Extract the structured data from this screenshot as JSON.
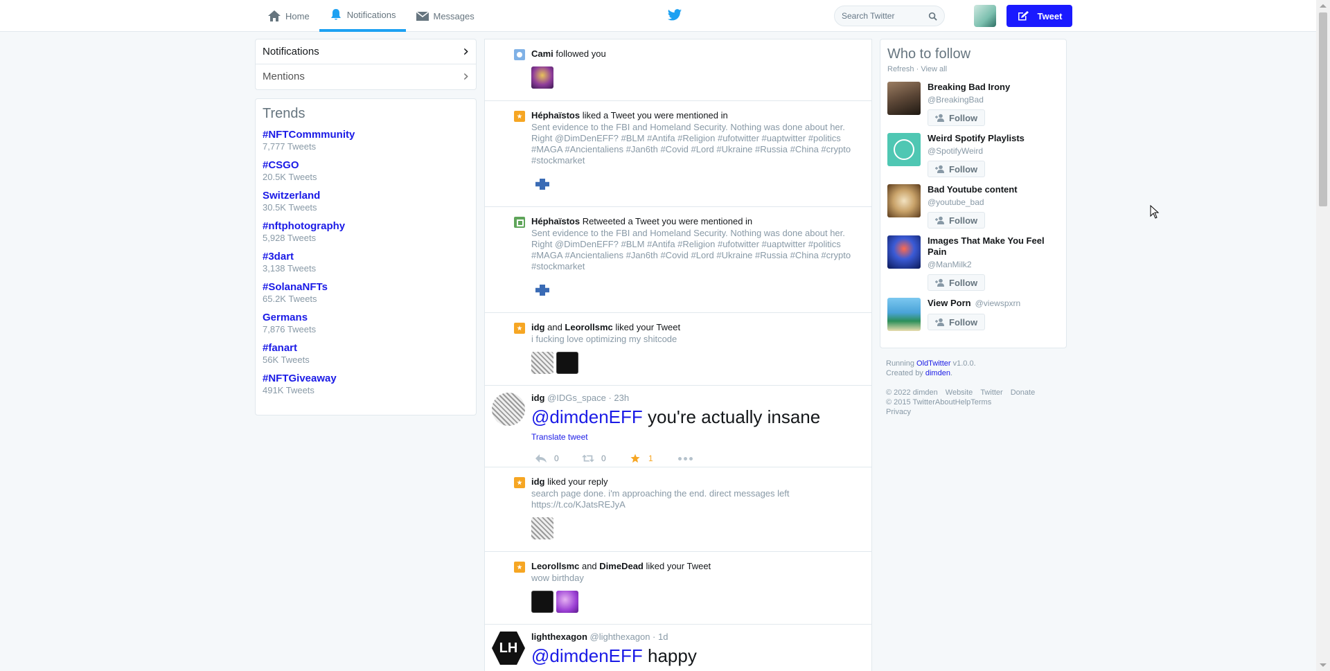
{
  "nav": {
    "home": "Home",
    "notifications": "Notifications",
    "messages": "Messages"
  },
  "search": {
    "placeholder": "Search Twitter"
  },
  "tweet_button": "Tweet",
  "left": {
    "menu": [
      "Notifications",
      "Mentions"
    ],
    "trends_title": "Trends",
    "trends": [
      {
        "name": "#NFTCommmunity",
        "count": "7,777 Tweets"
      },
      {
        "name": "#CSGO",
        "count": "20.5K Tweets"
      },
      {
        "name": "Switzerland",
        "count": "30.5K Tweets"
      },
      {
        "name": "#nftphotography",
        "count": "5,928 Tweets"
      },
      {
        "name": "#3dart",
        "count": "3,138 Tweets"
      },
      {
        "name": "#SolanaNFTs",
        "count": "65.2K Tweets"
      },
      {
        "name": "Germans",
        "count": "7,876 Tweets"
      },
      {
        "name": "#fanart",
        "count": "56K Tweets"
      },
      {
        "name": "#NFTGiveaway",
        "count": "491K Tweets"
      }
    ]
  },
  "feed": {
    "n1": {
      "user": "Cami",
      "action": " followed you"
    },
    "n2": {
      "user": "Héphaïstos",
      "action": " liked a Tweet you were mentioned in",
      "text": "Sent evidence to the FBI and Homeland Security. Nothing was done about her. Right @DimDenEFF? #BLM #Antifa #Religion #ufotwitter #uaptwitter #politics #MAGA #Ancientaliens #Jan6th #Covid #Lord #Ukraine #Russia #China #crypto #stockmarket"
    },
    "n3": {
      "user": "Héphaïstos",
      "action": " Retweeted a Tweet you were mentioned in",
      "text": "Sent evidence to the FBI and Homeland Security. Nothing was done about her. Right @DimDenEFF? #BLM #Antifa #Religion #ufotwitter #uaptwitter #politics #MAGA #Ancientaliens #Jan6th #Covid #Lord #Ukraine #Russia #China #crypto #stockmarket"
    },
    "n4": {
      "user1": "idg",
      "and": " and ",
      "user2": "Leorollsmc",
      "action": " liked your Tweet",
      "text": "i fucking love optimizing my shitcode"
    },
    "t1": {
      "name": "idg",
      "meta": " @IDGs_space · 23h",
      "mention": "@dimdenEFF",
      "body": " you're actually insane",
      "translate": "Translate tweet",
      "replies": "0",
      "retweets": "0",
      "likes": "1"
    },
    "n5": {
      "user": "idg",
      "action": " liked your reply",
      "text": "search page done. i'm approaching the end. direct messages left https://t.co/KJatsREJyA"
    },
    "n6": {
      "user1": "Leorollsmc",
      "and": " and ",
      "user2": "DimeDead",
      "action": " liked your Tweet",
      "text": "wow birthday"
    },
    "t2": {
      "name": "lighthexagon",
      "meta": " @lighthexagon · 1d",
      "mention": "@dimdenEFF",
      "body": " happy",
      "avatar_text": "LH"
    }
  },
  "right": {
    "title": "Who to follow",
    "refresh": "Refresh",
    "sep": " · ",
    "view_all": "View all",
    "follow_label": "Follow",
    "suggestions": [
      {
        "name": "Breaking Bad Irony",
        "handle": "@BreakingBad"
      },
      {
        "name": "Weird Spotify Playlists",
        "handle": "@SpotifyWeird"
      },
      {
        "name": "Bad Youtube content",
        "handle": "@youtube_bad"
      },
      {
        "name": "Images That Make You Feel Pain",
        "handle": "@ManMilk2"
      },
      {
        "name": "View Porn",
        "handle": "@viewspxrn"
      }
    ]
  },
  "footer": {
    "running": "Running ",
    "app": "OldTwitter",
    "version": " v1.0.0.",
    "created": "Created by ",
    "author": "dimden",
    "dot": ".",
    "links1": [
      "© 2022 dimden",
      "Website",
      "Twitter",
      "Donate"
    ],
    "links2": [
      "© 2015 Twitter",
      "About",
      "Help",
      "Terms",
      "Privacy"
    ]
  },
  "colors": {
    "accent": "#1da1f2",
    "link": "#1a1ae6",
    "tweet_button": "#1a1aff",
    "like": "#f6a623"
  }
}
